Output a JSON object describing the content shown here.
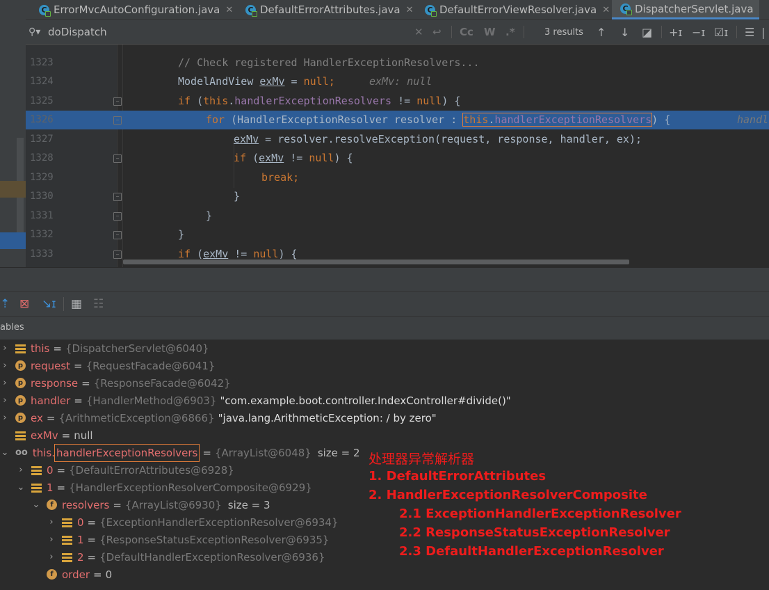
{
  "tabs": [
    {
      "label": "ErrorMvcAutoConfiguration.java",
      "icon": "class-c-icon"
    },
    {
      "label": "DefaultErrorAttributes.java",
      "icon": "class-c-icon"
    },
    {
      "label": "DefaultErrorViewResolver.java",
      "icon": "class-c-icon"
    },
    {
      "label": "DispatcherServlet.java",
      "icon": "class-c-icon",
      "active": true
    }
  ],
  "search": {
    "value": "doDispatch",
    "match_case_label": "Cc",
    "words_label": "W",
    "regex_label": ".*",
    "results": "3 results"
  },
  "code_lines": [
    {
      "num": "1323",
      "text": "// Check registered HandlerExceptionResolvers..."
    },
    {
      "num": "1324",
      "text": "ModelAndView exMv = null;",
      "hint": "exMv: null"
    },
    {
      "num": "1325",
      "text": "if (this.handlerExceptionResolvers != null) {"
    },
    {
      "num": "1326",
      "text": "for (HandlerExceptionResolver resolver : this.handlerExceptionResolvers) {",
      "hint": "handl"
    },
    {
      "num": "1327",
      "text": "exMv = resolver.resolveException(request, response, handler, ex);"
    },
    {
      "num": "1328",
      "text": "if (exMv != null) {"
    },
    {
      "num": "1329",
      "text": "break;"
    },
    {
      "num": "1330",
      "text": "}"
    },
    {
      "num": "1331",
      "text": "}"
    },
    {
      "num": "1332",
      "text": "}"
    },
    {
      "num": "1333",
      "text": "if (exMv != null) {"
    }
  ],
  "variables_header": "ables",
  "variables": [
    {
      "name": "this",
      "value": "{DispatcherServlet@6040}"
    },
    {
      "name": "request",
      "value": "{RequestFacade@6041}"
    },
    {
      "name": "response",
      "value": "{ResponseFacade@6042}"
    },
    {
      "name": "handler",
      "value": "{HandlerMethod@6903}",
      "str": "\"com.example.boot.controller.IndexController#divide()\""
    },
    {
      "name": "ex",
      "value": "{ArithmeticException@6866}",
      "str": "\"java.lang.ArithmeticException: / by zero\""
    },
    {
      "name": "exMv",
      "value": "null"
    },
    {
      "name_prefix": "this.",
      "name": "handlerExceptionResolvers",
      "value": "{ArrayList@6048}",
      "size": "size = 2"
    },
    {
      "name": "0",
      "value": "{DefaultErrorAttributes@6928}"
    },
    {
      "name": "1",
      "value": "{HandlerExceptionResolverComposite@6929}"
    },
    {
      "name": "resolvers",
      "value": "{ArrayList@6930}",
      "size": "size = 3"
    },
    {
      "name": "0",
      "value": "{ExceptionHandlerExceptionResolver@6934}"
    },
    {
      "name": "1",
      "value": "{ResponseStatusExceptionResolver@6935}"
    },
    {
      "name": "2",
      "value": "{DefaultHandlerExceptionResolver@6936}"
    },
    {
      "name": "order",
      "value": "0"
    }
  ],
  "annotation": [
    "处理器异常解析器",
    "1. DefaultErrorAttributes",
    "2. HandlerExceptionResolverComposite",
    "2.1 ExceptionHandlerExceptionResolver",
    "2.2 ResponseStatusExceptionResolver",
    "2.3 DefaultHandlerExceptionResolver"
  ],
  "colors": {
    "current_line": "#2d5c96",
    "keyword": "#cc7832",
    "field": "#9876aa",
    "var_name": "#e46f6f",
    "annotation": "#ee1c1c",
    "highlight_box": "#e07b39"
  }
}
